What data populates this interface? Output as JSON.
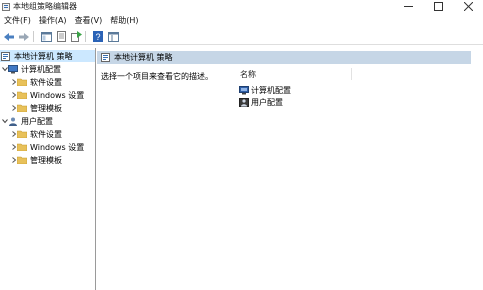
{
  "window": {
    "title": "本地组策略编辑器"
  },
  "menu": [
    "文件(F)",
    "操作(A)",
    "查看(V)",
    "帮助(H)"
  ],
  "tree": {
    "root": "本地计算机 策略",
    "computer_config": "计算机配置",
    "user_config": "用户配置",
    "children": [
      "软件设置",
      "Windows 设置",
      "管理模板"
    ]
  },
  "content": {
    "header_title": "本地计算机 策略",
    "description": "选择一个项目来查看它的描述。",
    "column_name": "名称",
    "items": [
      "计算机配置",
      "用户配置"
    ]
  },
  "colors": {
    "selection": "#cce8ff",
    "header_strip": "#c6d6e6",
    "folder": "#e8c15a"
  }
}
